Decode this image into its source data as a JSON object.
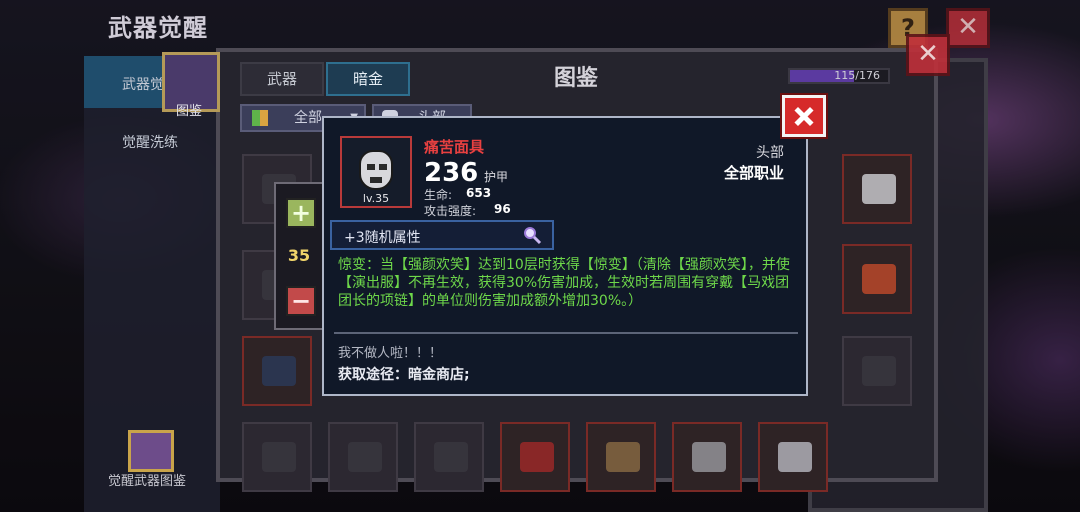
{
  "header": {
    "title": "武器觉醒",
    "help_glyph": "?",
    "close_glyph": "✕"
  },
  "left_nav": {
    "items": [
      {
        "label": "武器觉醒"
      },
      {
        "label": "觉醒洗练"
      }
    ],
    "bottom_label": "觉醒武器图鉴"
  },
  "book_button": {
    "label": "图鉴"
  },
  "panel": {
    "title": "图鉴",
    "tabs": [
      {
        "label": "武器"
      },
      {
        "label": "暗金"
      }
    ],
    "progress": {
      "text": "115/176",
      "current": 115,
      "total": 176
    },
    "filters": [
      {
        "label": "全部"
      },
      {
        "label": "头部"
      }
    ],
    "close_glyph": "✕"
  },
  "stepper": {
    "plus": "+",
    "value": "35",
    "minus": "−"
  },
  "popup": {
    "item": {
      "name": "痛苦面具",
      "level": "lv.35",
      "armor_value": "236",
      "armor_label": "护甲",
      "stats": [
        {
          "name": "生命:",
          "value": "653"
        },
        {
          "name": "攻击强度:",
          "value": "96"
        }
      ],
      "slot_type": "头部",
      "class": "全部职业"
    },
    "random_attr": "+3随机属性",
    "effect_text": "惊变：当【强颜欢笑】达到10层时获得【惊变】（清除【强颜欢笑】，并使【演出服】不再生效，获得30%伤害加成，生效时若周围有穿戴【马戏团团长的项链】的单位则伤害加成额外增加30%。）",
    "flavor_text": "我不做人啦！！！",
    "source_text": "获取途径：暗金商店;"
  },
  "colors": {
    "item_name": "#e84040",
    "effect": "#6ed84a",
    "accent_tab": "#1e3c52",
    "close_red": "#d62a2a"
  }
}
